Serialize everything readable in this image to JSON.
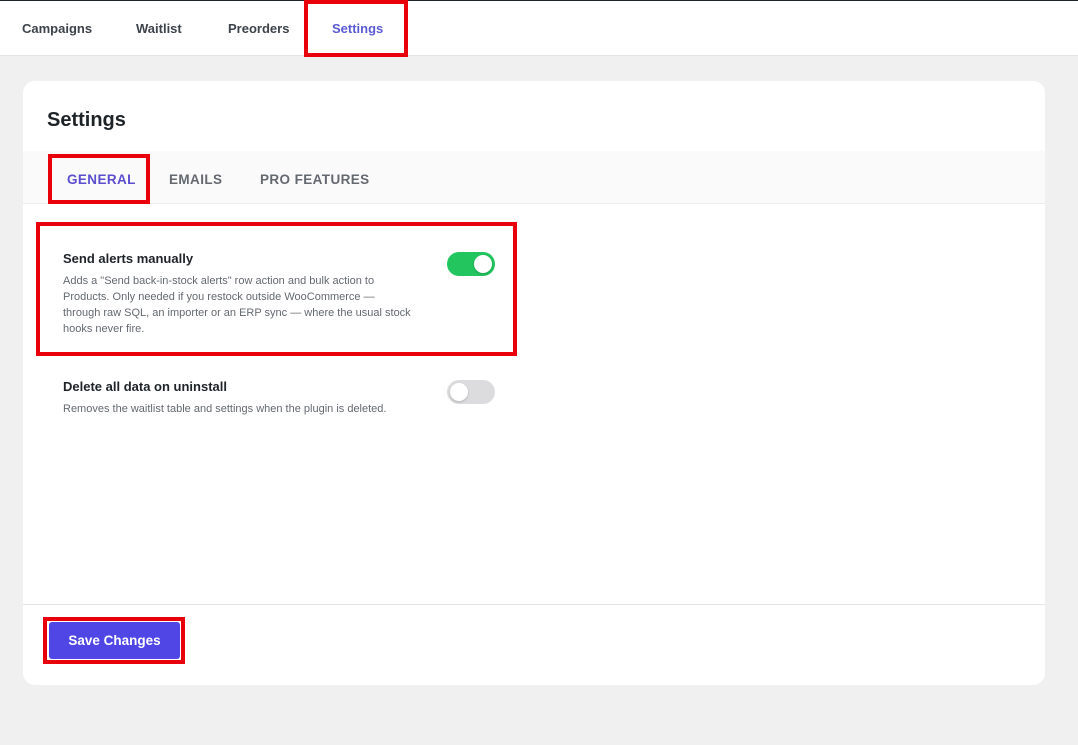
{
  "topnav": {
    "items": [
      {
        "label": "Campaigns",
        "active": false
      },
      {
        "label": "Waitlist",
        "active": false
      },
      {
        "label": "Preorders",
        "active": false
      },
      {
        "label": "Settings",
        "active": true
      }
    ]
  },
  "settings": {
    "title": "Settings",
    "tabs": [
      {
        "label": "GENERAL",
        "active": true
      },
      {
        "label": "EMAILS",
        "active": false
      },
      {
        "label": "PRO FEATURES",
        "active": false
      }
    ],
    "options": [
      {
        "title": "Send alerts manually",
        "description": "Adds a \"Send back-in-stock alerts\" row action and bulk action to Products. Only needed if you restock outside WooCommerce — through raw SQL, an importer or an ERP sync — where the usual stock hooks never fire.",
        "enabled": true
      },
      {
        "title": "Delete all data on uninstall",
        "description": "Removes the waitlist table and settings when the plugin is deleted.",
        "enabled": false
      }
    ],
    "save_label": "Save Changes"
  },
  "colors": {
    "accent": "#4f46e5",
    "toggle_on": "#22c55e",
    "toggle_off": "#dcdcde",
    "highlight": "#e8000b"
  }
}
